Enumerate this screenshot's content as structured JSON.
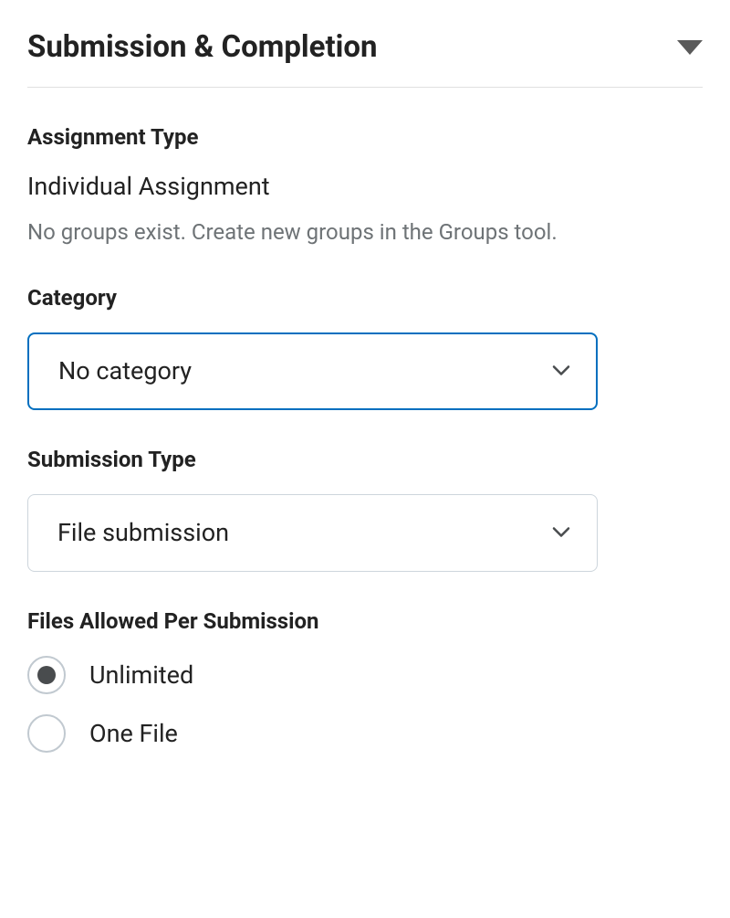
{
  "section": {
    "title": "Submission & Completion"
  },
  "assignmentType": {
    "label": "Assignment Type",
    "value": "Individual Assignment",
    "hint": "No groups exist. Create new groups in the Groups tool."
  },
  "category": {
    "label": "Category",
    "selected": "No category"
  },
  "submissionType": {
    "label": "Submission Type",
    "selected": "File submission"
  },
  "filesAllowed": {
    "label": "Files Allowed Per Submission",
    "options": [
      {
        "label": "Unlimited",
        "selected": true
      },
      {
        "label": "One File",
        "selected": false
      }
    ]
  }
}
